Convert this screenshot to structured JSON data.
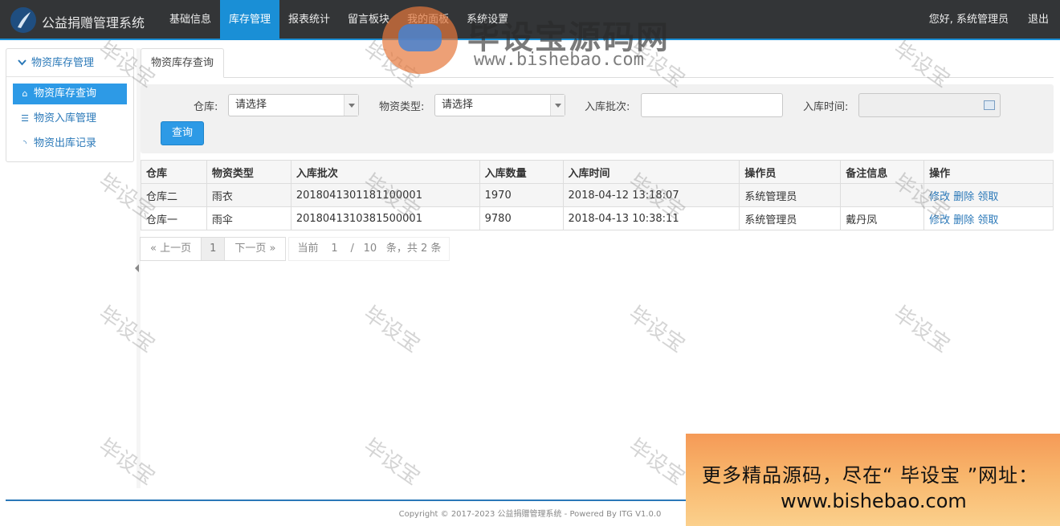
{
  "app": {
    "title": "公益捐赠管理系统"
  },
  "nav": {
    "items": [
      {
        "label": "基础信息",
        "active": false
      },
      {
        "label": "库存管理",
        "active": true
      },
      {
        "label": "报表统计",
        "active": false
      },
      {
        "label": "留言板块",
        "active": false
      },
      {
        "label": "我的面板",
        "active": false
      },
      {
        "label": "系统设置",
        "active": false
      }
    ],
    "greeting": "您好, 系统管理员",
    "logout": "退出"
  },
  "sidebar": {
    "header": "物资库存管理",
    "items": [
      {
        "label": "物资库存查询",
        "icon": "home-icon",
        "active": true
      },
      {
        "label": "物资入库管理",
        "icon": "list-icon",
        "active": false
      },
      {
        "label": "物资出库记录",
        "icon": "rss-icon",
        "active": false
      }
    ]
  },
  "tab": {
    "label": "物资库存查询"
  },
  "search": {
    "warehouse_label": "仓库:",
    "warehouse_value": "请选择",
    "type_label": "物资类型:",
    "type_value": "请选择",
    "batch_label": "入库批次:",
    "batch_value": "",
    "time_label": "入库时间:",
    "time_value": "",
    "query_button": "查询"
  },
  "table": {
    "columns": [
      "仓库",
      "物资类型",
      "入库批次",
      "入库数量",
      "入库时间",
      "操作员",
      "备注信息",
      "操作"
    ],
    "rows": [
      {
        "warehouse": "仓库二",
        "type": "雨衣",
        "batch": "2018041301181100001",
        "qty": "1970",
        "time": "2018-04-12 13:18:07",
        "operator": "系统管理员",
        "note": ""
      },
      {
        "warehouse": "仓库一",
        "type": "雨伞",
        "batch": "2018041310381500001",
        "qty": "9780",
        "time": "2018-04-13 10:38:11",
        "operator": "系统管理员",
        "note": "戴丹凤"
      }
    ],
    "actions": {
      "edit": "修改",
      "delete": "删除",
      "claim": "领取"
    }
  },
  "pager": {
    "prev": "« 上一页",
    "current_page": "1",
    "next": "下一页 »",
    "current_label": "当前",
    "current_value": "1",
    "separator": "/",
    "total_pages": "10",
    "summary": "条，共 2 条"
  },
  "footer": {
    "copyright": "Copyright © 2017-2023 公益捐赠管理系统 - Powered By ITG V1.0.0"
  },
  "watermark": {
    "text": "毕设宝",
    "site_name": "毕设宝源码网",
    "site_url": "www.bishebao.com"
  },
  "ad": {
    "line1": "更多精品源码，尽在“ 毕设宝 ”网址：",
    "line2": "www.bishebao.com"
  },
  "colors": {
    "accent": "#1a8fd6",
    "topbar": "#333537",
    "link": "#2a78b8"
  }
}
